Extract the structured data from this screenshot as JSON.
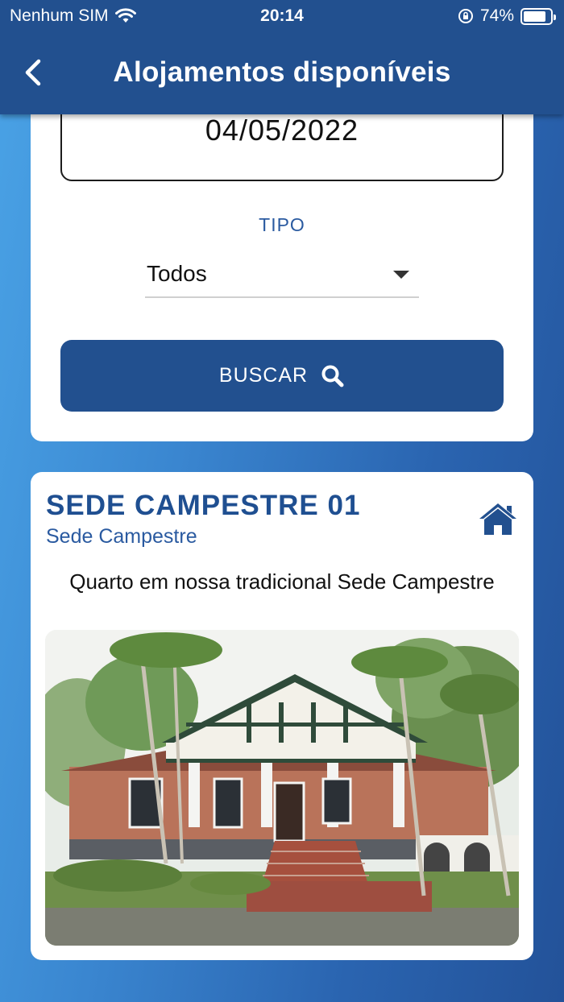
{
  "status_bar": {
    "carrier": "Nenhum SIM",
    "time": "20:14",
    "battery": "74%",
    "battery_level": 0.74
  },
  "header": {
    "title": "Alojamentos disponíveis",
    "back_icon": "chevron-left-icon"
  },
  "search": {
    "date_value": "04/05/2022",
    "tipo_label": "TIPO",
    "tipo_value": "Todos",
    "button_label": "BUSCAR",
    "button_icon": "search-icon"
  },
  "listing": {
    "title": "SEDE CAMPESTRE 01",
    "subtitle": "Sede Campestre",
    "description": "Quarto em nossa tradicional Sede Campestre",
    "icon": "house-icon"
  },
  "colors": {
    "primary": "#22508f",
    "accent_text": "#2a5aa0"
  }
}
